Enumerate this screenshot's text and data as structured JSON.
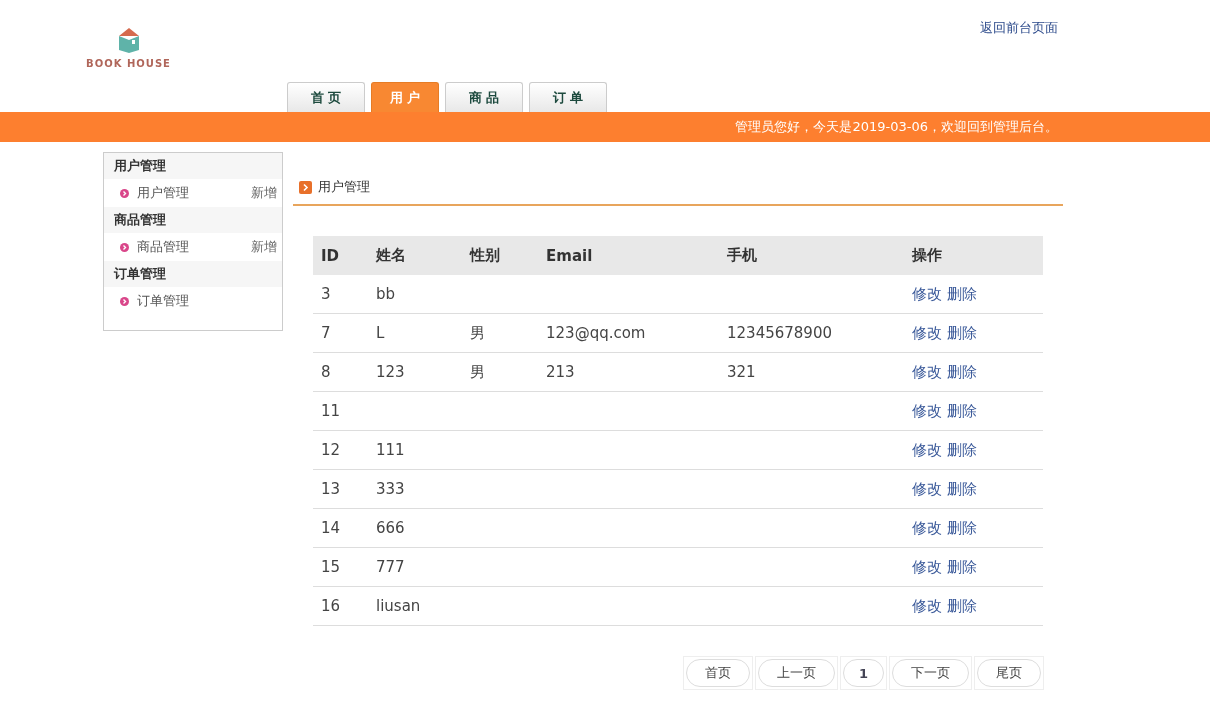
{
  "header": {
    "logo_text": "BOOK HOUSE",
    "back_link": "返回前台页面"
  },
  "tabs": [
    {
      "label": "首 页",
      "selected": false
    },
    {
      "label": "用 户",
      "selected": true
    },
    {
      "label": "商 品",
      "selected": false
    },
    {
      "label": "订 单",
      "selected": false
    }
  ],
  "banner": "管理员您好，今天是2019-03-06，欢迎回到管理后台。",
  "sidebar": {
    "groups": [
      {
        "title": "用户管理",
        "items": [
          {
            "label": "用户管理",
            "action": "新增"
          }
        ]
      },
      {
        "title": "商品管理",
        "items": [
          {
            "label": "商品管理",
            "action": "新增"
          }
        ]
      },
      {
        "title": "订单管理",
        "items": [
          {
            "label": "订单管理"
          }
        ]
      }
    ]
  },
  "section_title": "用户管理",
  "table": {
    "columns": [
      "ID",
      "姓名",
      "性别",
      "Email",
      "手机",
      "操作"
    ],
    "rows": [
      {
        "cells": [
          "3",
          "bb",
          "",
          "",
          ""
        ],
        "actions": [
          "修改",
          "删除"
        ]
      },
      {
        "cells": [
          "7",
          "L",
          "男",
          "123@qq.com",
          "12345678900"
        ],
        "actions": [
          "修改",
          "删除"
        ]
      },
      {
        "cells": [
          "8",
          "123",
          "男",
          "213",
          "321"
        ],
        "actions": [
          "修改",
          "删除"
        ]
      },
      {
        "cells": [
          "11",
          "",
          "",
          "",
          ""
        ],
        "actions": [
          "修改",
          "删除"
        ]
      },
      {
        "cells": [
          "12",
          "111",
          "",
          "",
          ""
        ],
        "actions": [
          "修改",
          "删除"
        ]
      },
      {
        "cells": [
          "13",
          "333",
          "",
          "",
          ""
        ],
        "actions": [
          "修改",
          "删除"
        ]
      },
      {
        "cells": [
          "14",
          "666",
          "",
          "",
          ""
        ],
        "actions": [
          "修改",
          "删除"
        ]
      },
      {
        "cells": [
          "15",
          "777",
          "",
          "",
          ""
        ],
        "actions": [
          "修改",
          "删除"
        ]
      },
      {
        "cells": [
          "16",
          "liusan",
          "",
          "",
          ""
        ],
        "actions": [
          "修改",
          "删除"
        ]
      }
    ]
  },
  "pagination": [
    {
      "label": "首页",
      "kind": "nav"
    },
    {
      "label": "上一页",
      "kind": "nav"
    },
    {
      "label": "1",
      "kind": "page"
    },
    {
      "label": "下一页",
      "kind": "nav"
    },
    {
      "label": "尾页",
      "kind": "nav"
    }
  ]
}
